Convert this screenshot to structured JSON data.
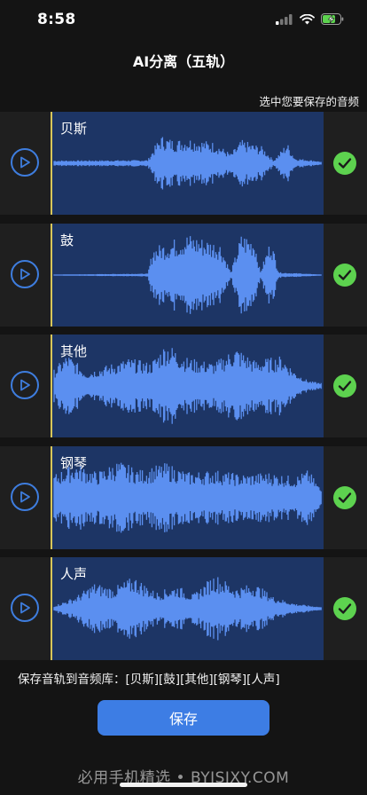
{
  "status_bar": {
    "time": "8:58",
    "icons": [
      "cellular-signal-icon",
      "wifi-icon",
      "battery-charging-icon"
    ]
  },
  "header": {
    "title": "AI分离（五轨）",
    "hint": "选中您要保存的音频"
  },
  "tracks": [
    {
      "name": "贝斯",
      "selected": true
    },
    {
      "name": "鼓",
      "selected": true
    },
    {
      "name": "其他",
      "selected": true
    },
    {
      "name": "钢琴",
      "selected": true
    },
    {
      "name": "人声",
      "selected": true
    }
  ],
  "footer": {
    "save_library_text": "保存音轨到音频库：[贝斯][鼓][其他][钢琴][人声]",
    "save_button": "保存"
  },
  "watermark": "必用手机精选 • BYJSJXY.COM",
  "colors": {
    "accent": "#3d7de4",
    "wave": "#5b8ff0",
    "wave_bg": "#1d3565",
    "check": "#5dd24f",
    "cursor": "#d7c65a"
  }
}
